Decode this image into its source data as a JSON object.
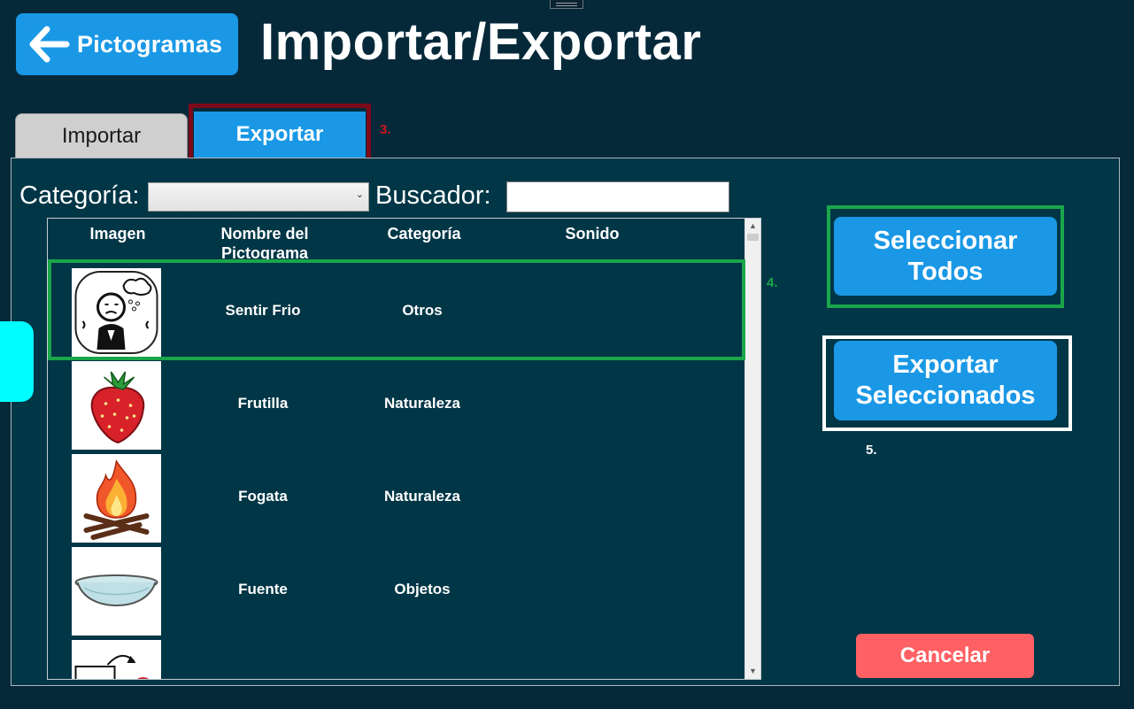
{
  "header": {
    "back_label": "Pictogramas",
    "title": "Importar/Exportar"
  },
  "tabs": [
    {
      "label": "Importar",
      "active": false
    },
    {
      "label": "Exportar",
      "active": true
    }
  ],
  "annotations": {
    "step3": "3.",
    "step4": "4.",
    "step5": "5."
  },
  "filters": {
    "category_label": "Categoría:",
    "category_value": "",
    "search_label": "Buscador:",
    "search_value": ""
  },
  "table": {
    "columns": [
      "Imagen",
      "Nombre del Pictograma",
      "Categoría",
      "Sonido"
    ],
    "rows": [
      {
        "name": "Sentir Frio",
        "category": "Otros",
        "sound": "",
        "image": "person-cold-icon"
      },
      {
        "name": "Frutilla",
        "category": "Naturaleza",
        "sound": "",
        "image": "strawberry-icon"
      },
      {
        "name": "Fogata",
        "category": "Naturaleza",
        "sound": "",
        "image": "campfire-icon"
      },
      {
        "name": "Fuente",
        "category": "Objetos",
        "sound": "",
        "image": "bowl-icon"
      },
      {
        "name": "",
        "category": "",
        "sound": "",
        "image": "partial-icon"
      }
    ]
  },
  "actions": {
    "select_all": "Seleccionar Todos",
    "export_selected": "Exportar Seleccionados",
    "cancel": "Cancelar"
  },
  "colors": {
    "background": "#06293a",
    "panel": "#003646",
    "accent": "#1a98e6",
    "cancel": "#ff6063",
    "highlight_tab": "#7d0a1a",
    "highlight_green": "#1aa64a",
    "side_handle": "#00fdfd"
  }
}
